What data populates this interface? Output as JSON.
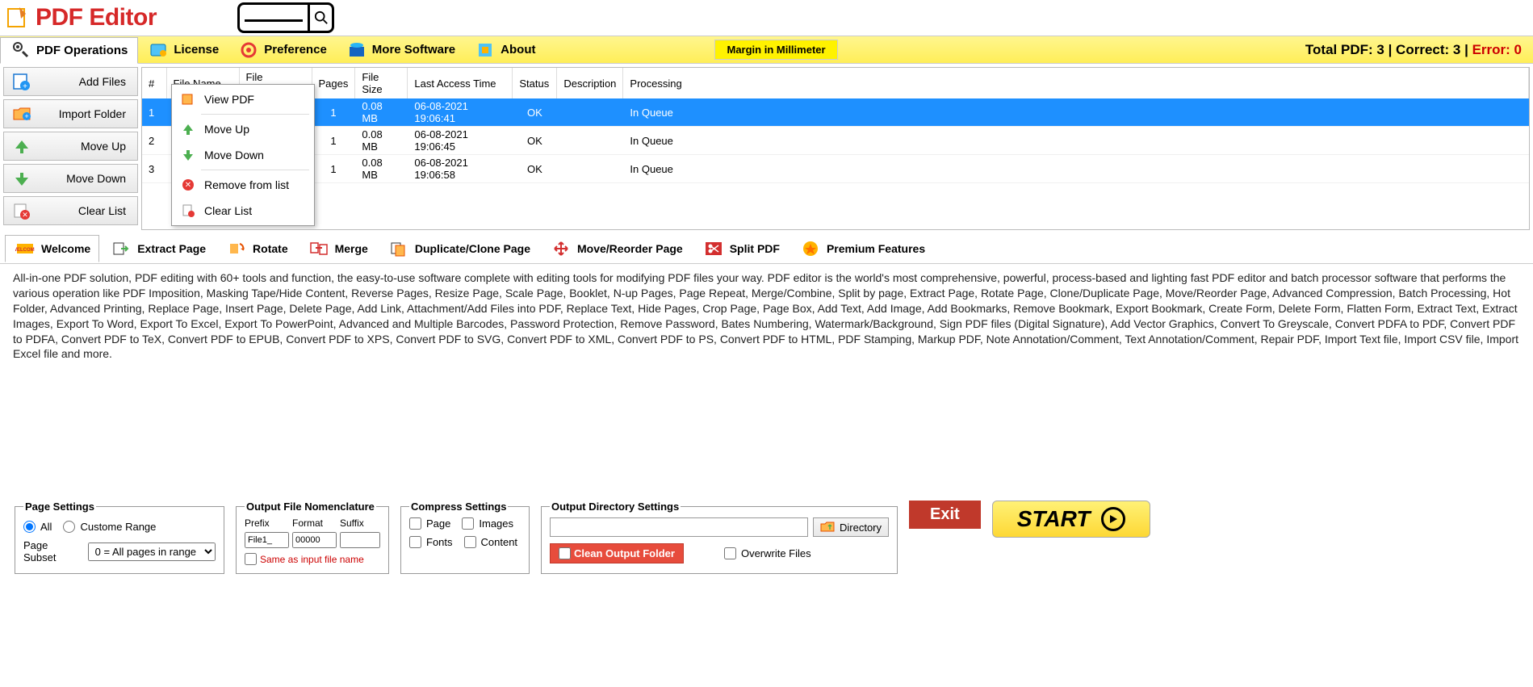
{
  "app": {
    "title": "PDF Editor"
  },
  "toolbar": {
    "items": [
      "PDF Operations",
      "License",
      "Preference",
      "More Software",
      "About"
    ],
    "margin_label": "Margin in Millimeter",
    "stats_prefix": "Total PDF: ",
    "stats_total": "3",
    "stats_correct_prefix": "  |  Correct: ",
    "stats_correct": "3",
    "stats_error_prefix": "  |  ",
    "stats_error_label": "Error: 0"
  },
  "sidebar": {
    "items": [
      "Add Files",
      "Import Folder",
      "Move Up",
      "Move Down",
      "Clear List"
    ]
  },
  "table": {
    "headers": [
      "#",
      "File Name",
      "File Password",
      "Pages",
      "File Size",
      "Last Access Time",
      "Status",
      "Description",
      "Processing"
    ],
    "rows": [
      {
        "n": "1",
        "name": "",
        "pw": "",
        "pages": "1",
        "size": "0.08 MB",
        "time": "06-08-2021 19:06:41",
        "status": "OK",
        "desc": "",
        "proc": "In Queue"
      },
      {
        "n": "2",
        "name": "",
        "pw": "",
        "pages": "1",
        "size": "0.08 MB",
        "time": "06-08-2021 19:06:45",
        "status": "OK",
        "desc": "",
        "proc": "In Queue"
      },
      {
        "n": "3",
        "name": "",
        "pw": "",
        "pages": "1",
        "size": "0.08 MB",
        "time": "06-08-2021 19:06:58",
        "status": "OK",
        "desc": "",
        "proc": "In Queue"
      }
    ]
  },
  "context_menu": {
    "items": [
      "View PDF",
      "Move Up",
      "Move Down",
      "Remove from list",
      "Clear List"
    ]
  },
  "tabs": {
    "items": [
      "Welcome",
      "Extract Page",
      "Rotate",
      "Merge",
      "Duplicate/Clone Page",
      "Move/Reorder Page",
      "Split PDF",
      "Premium Features"
    ]
  },
  "description": "All-in-one PDF solution, PDF editing with 60+ tools and function, the easy-to-use software complete with editing tools for modifying PDF files your way. PDF editor is the world's most comprehensive, powerful, process-based and lighting fast PDF editor and batch processor software that performs the various operation like PDF Imposition, Masking Tape/Hide Content, Reverse Pages, Resize Page, Scale Page, Booklet, N-up Pages, Page Repeat, Merge/Combine, Split by page, Extract Page, Rotate Page, Clone/Duplicate Page, Move/Reorder Page, Advanced Compression, Batch Processing, Hot Folder, Advanced Printing, Replace Page, Insert Page, Delete Page, Add Link, Attachment/Add Files into PDF, Replace Text, Hide Pages, Crop Page, Page Box, Add Text, Add Image, Add Bookmarks, Remove Bookmark, Export Bookmark, Create Form, Delete Form, Flatten Form, Extract Text, Extract Images, Export To Word, Export To Excel, Export To PowerPoint, Advanced and Multiple Barcodes, Password Protection, Remove Password, Bates Numbering,  Watermark/Background, Sign PDF files (Digital Signature), Add Vector Graphics, Convert To Greyscale, Convert PDFA to PDF, Convert PDF to PDFA, Convert PDF to TeX, Convert PDF to EPUB, Convert PDF to XPS, Convert PDF to SVG, Convert PDF to XML, Convert PDF to PS, Convert PDF to HTML, PDF Stamping, Markup PDF, Note Annotation/Comment, Text Annotation/Comment, Repair PDF, Import Text file, Import CSV file, Import Excel file and more.",
  "page_settings": {
    "legend": "Page Settings",
    "all": "All",
    "custom": "Custome Range",
    "subset_label": "Page Subset",
    "subset_value": "0 = All pages in range"
  },
  "nomenclature": {
    "legend": "Output File Nomenclature",
    "prefix_h": "Prefix",
    "format_h": "Format",
    "suffix_h": "Suffix",
    "prefix_v": "File1_",
    "format_v": "00000",
    "suffix_v": "",
    "same": "Same as input file name"
  },
  "compress": {
    "legend": "Compress Settings",
    "page": "Page",
    "images": "Images",
    "fonts": "Fonts",
    "content": "Content"
  },
  "output": {
    "legend": "Output Directory Settings",
    "directory": "Directory",
    "clean": "Clean Output Folder",
    "overwrite": "Overwrite Files"
  },
  "actions": {
    "exit": "Exit",
    "start": "START"
  }
}
